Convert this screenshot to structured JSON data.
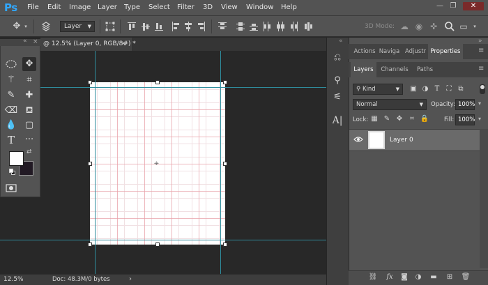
{
  "app": {
    "logo": "Ps",
    "menu": [
      "File",
      "Edit",
      "Image",
      "Layer",
      "Type",
      "Select",
      "Filter",
      "3D",
      "View",
      "Window",
      "Help"
    ]
  },
  "options_bar": {
    "auto_select_target": "Layer",
    "mode_3d_label": "3D Mode:"
  },
  "document": {
    "tab_title": "@ 12.5% (Layer 0, RGB/8#) *",
    "close_glyph": "×"
  },
  "status_bar": {
    "zoom": "12.5%",
    "doc_info": "Doc: 48.3M/0 bytes",
    "arrow": "›"
  },
  "panels": {
    "top_tabs": [
      "Actions",
      "Naviga",
      "Adjustr",
      "Properties"
    ],
    "top_tabs_active": "Properties",
    "layer_tabs": [
      "Layers",
      "Channels",
      "Paths"
    ],
    "layer_tabs_active": "Layers",
    "filter_kind": "Kind",
    "blend_mode": "Normal",
    "opacity_label": "Opacity:",
    "opacity_value": "100%",
    "lock_label": "Lock:",
    "fill_label": "Fill:",
    "fill_value": "100%",
    "layers": [
      {
        "name": "Layer 0",
        "visible": true,
        "selected": true
      }
    ]
  },
  "colors": {
    "foreground": "#ffffff",
    "background": "#221a24",
    "guide": "#2f8c9c",
    "grid": "#e8a0a8",
    "accent_logo": "#31a8ff"
  },
  "icons": {
    "tools": [
      "marquee-icon",
      "move-icon",
      "magic-wand-icon",
      "crop-icon",
      "brush-icon",
      "healing-icon",
      "eraser-icon",
      "paint-bucket-icon",
      "blur-icon",
      "shape-icon",
      "type-icon",
      "more-tools-icon",
      "quick-mask-icon"
    ],
    "strip": [
      "history-icon",
      "brush-presets-icon",
      "swatches-icon",
      "character-icon"
    ]
  }
}
